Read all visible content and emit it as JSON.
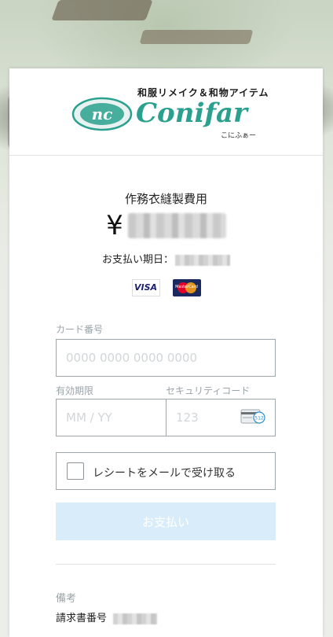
{
  "brand": {
    "tagline": "和服リメイク＆和物アイテム",
    "name": "Conifar",
    "kana": "こにふぁー",
    "emblem": "nc"
  },
  "payment": {
    "title": "作務衣縫製費用",
    "currency_symbol": "¥",
    "due_label": "お支払い期日："
  },
  "card_brands": [
    "VISA",
    "MasterCard"
  ],
  "form": {
    "card_number_label": "カード番号",
    "card_number_placeholder": "0000 0000 0000 0000",
    "expiry_label": "有効期限",
    "expiry_placeholder": "MM / YY",
    "cvc_label": "セキュリティコード",
    "cvc_placeholder": "123",
    "cvc_icon_text": "512",
    "receipt_label": "レシートをメールで受け取る",
    "pay_button": "お支払い"
  },
  "remarks": {
    "heading": "備考",
    "invoice_label": "請求書番号"
  },
  "colors": {
    "brand_teal": "#2aa08e",
    "pay_button_bg": "#d8edf9",
    "label_gray": "#9aa4a8",
    "input_border": "#9ea7ab"
  }
}
